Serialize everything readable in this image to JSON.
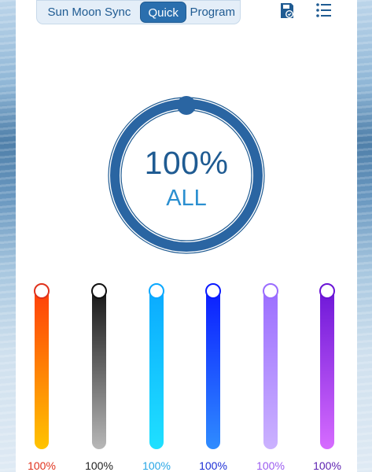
{
  "tabs": [
    {
      "label": "Sun Moon Sync",
      "active": false
    },
    {
      "label": "Quick",
      "active": true
    },
    {
      "label": "Program",
      "active": false
    }
  ],
  "icons": {
    "save": "save-icon",
    "menu": "list-menu-icon"
  },
  "dial": {
    "value": "100%",
    "label": "ALL",
    "level": 1.0,
    "color": "#1f5b92"
  },
  "channels": [
    {
      "name": "channel-red",
      "percent": "100%",
      "level": 1.0,
      "color_top": "#ff3a0a",
      "color_bottom": "#ffc400",
      "label_color": "#e0321c",
      "knob_color": "#e0321c"
    },
    {
      "name": "channel-white",
      "percent": "100%",
      "level": 1.0,
      "color_top": "#111111",
      "color_bottom": "#b8b8b8",
      "label_color": "#222222",
      "knob_color": "#111111"
    },
    {
      "name": "channel-cyan",
      "percent": "100%",
      "level": 1.0,
      "color_top": "#0aa8ff",
      "color_bottom": "#1fe0ff",
      "label_color": "#27a6e6",
      "knob_color": "#0aa8ff"
    },
    {
      "name": "channel-blue",
      "percent": "100%",
      "level": 1.0,
      "color_top": "#0a1aff",
      "color_bottom": "#2f8cff",
      "label_color": "#1d2fd6",
      "knob_color": "#0a1aff"
    },
    {
      "name": "channel-violet",
      "percent": "100%",
      "level": 1.0,
      "color_top": "#9a6cff",
      "color_bottom": "#cbb2ff",
      "label_color": "#9b5cf0",
      "knob_color": "#9a6cff"
    },
    {
      "name": "channel-purple",
      "percent": "100%",
      "level": 1.0,
      "color_top": "#6a14d6",
      "color_bottom": "#d66cff",
      "label_color": "#5b1fb0",
      "knob_color": "#6a14d6"
    }
  ]
}
